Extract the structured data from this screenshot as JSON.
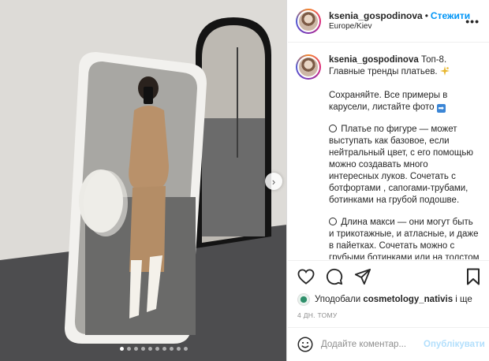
{
  "post": {
    "username": "ksenia_gospodinova",
    "separator": "•",
    "follow_label": "Стежити",
    "location": "Europe/Kiev",
    "more_icon": "more-horizontal-icon"
  },
  "caption": {
    "username": "ksenia_gospodinova",
    "title": "Топ-8. Главные тренды платьев.",
    "p1": "Сохраняйте. Все примеры в карусели, листайте фото",
    "p2": "Платье по фигуре — может выступать как базовое, если нейтральный цвет, с его помощью можно создавать много интересных луков. Сочетать с ботфортами , сапогами-трубами, ботинками на грубой подошве.",
    "p3": "Длина макси — они могут быть и трикотажные, и атласные, и даже в пайетках. Сочетать можно с грубыми ботинками или на толстом устойчивом ходу."
  },
  "actions": {
    "like_icon": "heart-icon",
    "comment_icon": "comment-icon",
    "share_icon": "paper-plane-icon",
    "save_icon": "bookmark-icon"
  },
  "likes": {
    "prefix": "Уподобали",
    "user": "cosmetology_nativis",
    "suffix": "і ще"
  },
  "time": "4 ДН. ТОМУ",
  "comment_box": {
    "placeholder": "Додайте коментар...",
    "publish_label": "Опублікувати"
  },
  "carousel": {
    "total": 10,
    "active": 0
  },
  "colors": {
    "accent": "#0095f6",
    "publish_disabled": "#b2dffc"
  }
}
